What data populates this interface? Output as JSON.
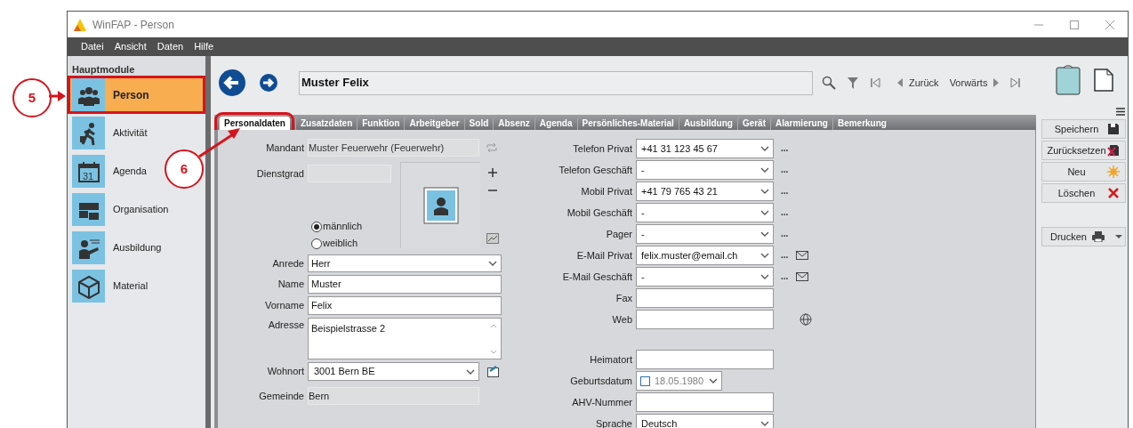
{
  "window": {
    "title": "WinFAP - Person"
  },
  "menu": [
    "Datei",
    "Ansicht",
    "Daten",
    "Hilfe"
  ],
  "sidebar": {
    "header": "Hauptmodule",
    "items": [
      {
        "label": "Person",
        "kind": "people",
        "selected": true
      },
      {
        "label": "Aktivität",
        "kind": "walker",
        "selected": false
      },
      {
        "label": "Agenda",
        "kind": "calendar",
        "selected": false
      },
      {
        "label": "Organisation",
        "kind": "folders",
        "selected": false
      },
      {
        "label": "Ausbildung",
        "kind": "teacher",
        "selected": false
      },
      {
        "label": "Material",
        "kind": "cube",
        "selected": false
      }
    ]
  },
  "calendar_day": "31",
  "record": {
    "title": "Muster Felix",
    "back": "Zurück",
    "forward": "Vorwärts"
  },
  "tabs": [
    {
      "label": "Personaldaten",
      "selected": true
    },
    {
      "label": "Zusatzdaten",
      "selected": false
    },
    {
      "label": "Funktion",
      "selected": false
    },
    {
      "label": "Arbeitgeber",
      "selected": false
    },
    {
      "label": "Sold",
      "selected": false
    },
    {
      "label": "Absenz",
      "selected": false
    },
    {
      "label": "Agenda",
      "selected": false
    },
    {
      "label": "Persönliches-Material",
      "selected": false
    },
    {
      "label": "Ausbildung",
      "selected": false
    },
    {
      "label": "Gerät",
      "selected": false
    },
    {
      "label": "Alarmierung",
      "selected": false
    },
    {
      "label": "Bemerkung",
      "selected": false
    }
  ],
  "mandant": {
    "label": "Mandant",
    "value": "Muster Feuerwehr (Feuerwehr)"
  },
  "dienstgrad": {
    "label": "Dienstgrad"
  },
  "gender": [
    {
      "label": "männlich",
      "selected": true
    },
    {
      "label": "weiblich",
      "selected": false
    }
  ],
  "left_fields": [
    {
      "label": "Anrede",
      "value": "Herr",
      "kind": "select"
    },
    {
      "label": "Name",
      "value": "Muster",
      "kind": "text"
    },
    {
      "label": "Vorname",
      "value": "Felix",
      "kind": "text"
    },
    {
      "label": "Adresse",
      "value": "Beispielstrasse 2",
      "kind": "textarea"
    },
    {
      "label": "Wohnort",
      "value": "3001 Bern BE",
      "kind": "place"
    },
    {
      "label": "Gemeinde",
      "value": "Bern",
      "kind": "readonly"
    }
  ],
  "right_fields": [
    {
      "label": "Telefon Privat",
      "value": "+41 31 123 45 67",
      "kind": "select",
      "more": "...",
      "mail": false,
      "web": false
    },
    {
      "label": "Telefon Geschäft",
      "value": "-",
      "kind": "select",
      "more": "...",
      "mail": false,
      "web": false
    },
    {
      "label": "Mobil Privat",
      "value": "+41 79 765 43 21",
      "kind": "select",
      "more": "...",
      "mail": false,
      "web": false
    },
    {
      "label": "Mobil Geschäft",
      "value": "-",
      "kind": "select",
      "more": "...",
      "mail": false,
      "web": false
    },
    {
      "label": "Pager",
      "value": "-",
      "kind": "select",
      "more": "...",
      "mail": false,
      "web": false
    },
    {
      "label": "E-Mail Privat",
      "value": "felix.muster@email.ch",
      "kind": "select",
      "more": "...",
      "mail": true,
      "web": false
    },
    {
      "label": "E-Mail Geschäft",
      "value": "-",
      "kind": "select",
      "more": "...",
      "mail": true,
      "web": false
    },
    {
      "label": "Fax",
      "kind": "text",
      "mail": false,
      "web": false
    },
    {
      "label": "Web",
      "kind": "text",
      "mail": false,
      "web": true
    }
  ],
  "personal_fields": [
    {
      "label": "Heimatort",
      "kind": "text"
    },
    {
      "label": "Geburtsdatum",
      "value": "18.05.1980",
      "kind": "date",
      "checked": false
    },
    {
      "label": "AHV-Nummer",
      "kind": "text"
    },
    {
      "label": "Sprache",
      "value": "Deutsch",
      "kind": "select"
    }
  ],
  "actions": [
    {
      "label": "Speichern",
      "kind": "save"
    },
    {
      "label": "Zurücksetzen",
      "kind": "reset"
    },
    {
      "label": "Neu",
      "kind": "new"
    },
    {
      "label": "Löschen",
      "kind": "delete"
    }
  ],
  "print": {
    "label": "Drucken"
  },
  "annotations": [
    {
      "number": "5"
    },
    {
      "number": "6"
    }
  ]
}
